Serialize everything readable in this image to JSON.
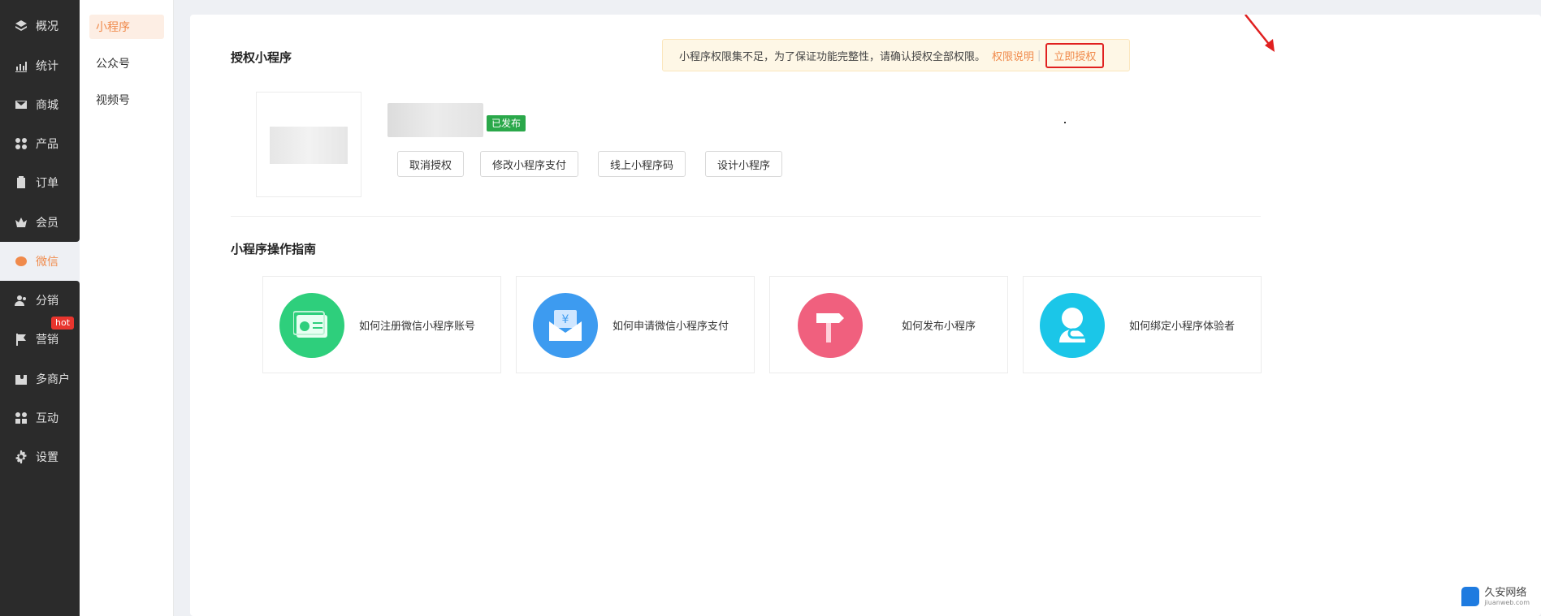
{
  "nav": {
    "items": [
      {
        "label": "概况",
        "icon": "layers-icon"
      },
      {
        "label": "统计",
        "icon": "chart-icon"
      },
      {
        "label": "商城",
        "icon": "mail-icon"
      },
      {
        "label": "产品",
        "icon": "grid-icon"
      },
      {
        "label": "订单",
        "icon": "clipboard-icon"
      },
      {
        "label": "会员",
        "icon": "crown-icon"
      },
      {
        "label": "微信",
        "icon": "wechat-icon"
      },
      {
        "label": "分销",
        "icon": "users-icon"
      },
      {
        "label": "营销",
        "icon": "flag-icon"
      },
      {
        "label": "多商户",
        "icon": "puzzle-icon"
      },
      {
        "label": "互动",
        "icon": "people-icon"
      },
      {
        "label": "设置",
        "icon": "gear-icon"
      }
    ],
    "hot_badge": "hot",
    "active_color": "#f08a4b"
  },
  "subnav": {
    "items": [
      "小程序",
      "公众号",
      "视频号"
    ]
  },
  "auth": {
    "title": "授权小程序",
    "notice_text": "小程序权限集不足，为了保证功能完整性，请确认授权全部权限。",
    "permission_link": "权限说明",
    "authorize_now": "立即授权",
    "status": "已发布",
    "buttons": [
      "取消授权",
      "修改小程序支付",
      "线上小程序码",
      "设计小程序"
    ]
  },
  "guide": {
    "title": "小程序操作指南",
    "cards": [
      {
        "label": "如何注册微信小程序账号",
        "color": "#2ecf7c"
      },
      {
        "label": "如何申请微信小程序支付",
        "color": "#3d9bf0"
      },
      {
        "label": "如何发布小程序",
        "color": "#f0607e"
      },
      {
        "label": "如何绑定小程序体验者",
        "color": "#1bc6e8"
      }
    ]
  },
  "watermark": {
    "name": "久安网络",
    "sub": "jiuanweb.com"
  }
}
